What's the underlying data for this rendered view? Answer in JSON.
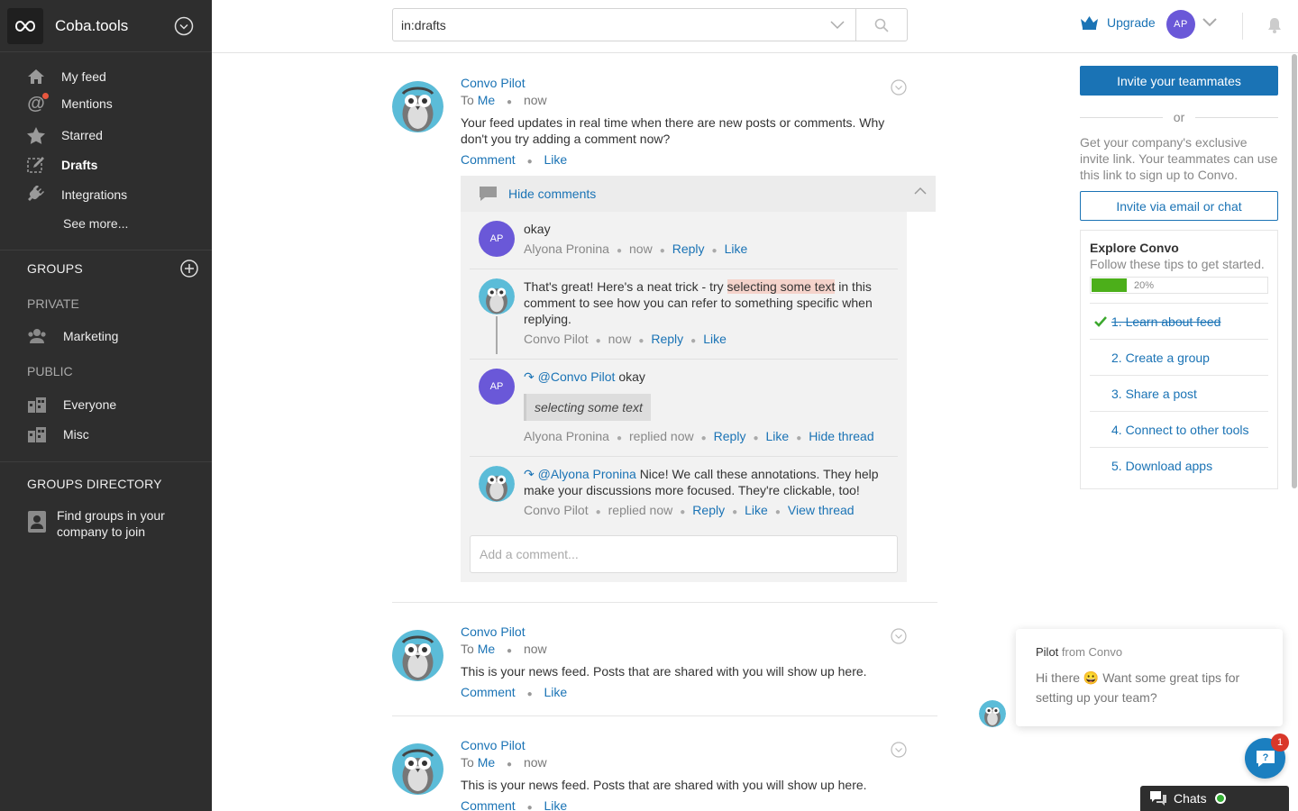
{
  "brand": {
    "name": "Coba.tools"
  },
  "nav": [
    {
      "label": "My feed",
      "icon": "home-icon"
    },
    {
      "label": "Mentions",
      "icon": "at-icon"
    },
    {
      "label": "Starred",
      "icon": "star-icon"
    },
    {
      "label": "Drafts",
      "icon": "drafts-icon"
    },
    {
      "label": "Integrations",
      "icon": "plug-icon"
    }
  ],
  "see_more": "See more...",
  "groups": {
    "title": "GROUPS",
    "private_label": "PRIVATE",
    "private": [
      "Marketing"
    ],
    "public_label": "PUBLIC",
    "public": [
      "Everyone",
      "Misc"
    ],
    "directory_title": "GROUPS DIRECTORY",
    "directory_item": "Find groups in your company to join"
  },
  "search": {
    "value": "in:drafts"
  },
  "topbar": {
    "upgrade": "Upgrade",
    "avatar": "AP"
  },
  "posts": [
    {
      "author": "Convo Pilot",
      "to_label": "To",
      "to": "Me",
      "time": "now",
      "text": "Your feed updates in real time when there are new posts or comments. Why don't you try adding a comment now?",
      "comment_label": "Comment",
      "like_label": "Like"
    },
    {
      "author": "Convo Pilot",
      "to_label": "To",
      "to": "Me",
      "time": "now",
      "text": "This is your news feed. Posts that are shared with you will show up here.",
      "comment_label": "Comment",
      "like_label": "Like"
    },
    {
      "author": "Convo Pilot",
      "to_label": "To",
      "to": "Me",
      "time": "now",
      "text": "This is your news feed. Posts that are shared with you will show up here.",
      "comment_label": "Comment",
      "like_label": "Like"
    }
  ],
  "comments_panel": {
    "hide_label": "Hide comments",
    "placeholder": "Add a comment...",
    "c1": {
      "avatar": "AP",
      "text": "okay",
      "author": "Alyona Pronina",
      "time": "now",
      "reply": "Reply",
      "like": "Like"
    },
    "c2": {
      "text_before": "That's great! Here's a neat trick - try ",
      "text_highlight": "selecting some text",
      "text_after": " in this comment to see how you can refer to something specific when replying.",
      "author": "Convo Pilot",
      "time": "now",
      "reply": "Reply",
      "like": "Like"
    },
    "c3": {
      "avatar": "AP",
      "mention": "@Convo Pilot",
      "text": "okay",
      "quote": "selecting some text",
      "author": "Alyona Pronina",
      "time": "replied now",
      "reply": "Reply",
      "like": "Like",
      "thread": "Hide thread"
    },
    "c4": {
      "mention": "@Alyona Pronina",
      "text": "Nice! We call these annotations. They help make your discussions more focused. They're clickable, too!",
      "author": "Convo Pilot",
      "time": "replied now",
      "reply": "Reply",
      "like": "Like",
      "thread": "View thread"
    }
  },
  "right": {
    "invite_button": "Invite your teammates",
    "or": "or",
    "invite_desc": "Get your company's exclusive invite link. Your teammates can use this link to sign up to Convo.",
    "invite_email": "Invite via email or chat",
    "explore_title": "Explore Convo",
    "explore_sub": "Follow these tips to get started.",
    "progress_label": "20%",
    "progress_value": 0.2,
    "steps": [
      "1. Learn about feed",
      "2. Create a group",
      "3. Share a post",
      "4. Connect to other tools",
      "5. Download apps"
    ]
  },
  "pilot_popup": {
    "name": "Pilot",
    "from": "from Convo",
    "message": "Hi there 😀 Want some great tips for setting up your team?"
  },
  "help": {
    "badge": "1"
  },
  "chats": {
    "label": "Chats"
  },
  "colors": {
    "accent": "#1a73b5",
    "sidebar": "#2e2e2e",
    "avatar": "#6a58d8",
    "progress": "#4caf1a"
  }
}
